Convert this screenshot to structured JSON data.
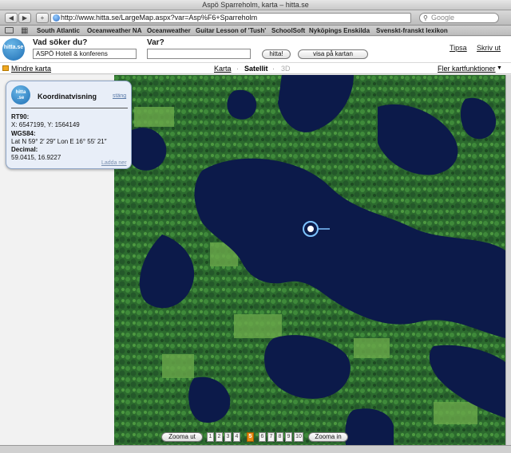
{
  "window": {
    "title": "Aspö Sparreholm, karta – hitta.se"
  },
  "toolbar": {
    "back": "◀",
    "forward": "▶",
    "add": "+",
    "url": "http://www.hitta.se/LargeMap.aspx?var=Asp%F6+Sparreholm",
    "reload": "C",
    "search_placeholder": "Google"
  },
  "bookmarks": [
    "South Atlantic",
    "Oceanweather NA",
    "Oceanweather",
    "Guitar Lesson of 'Tush'",
    "SchoolSoft",
    "Nyköpings Enskilda",
    "Svenskt-franskt lexikon"
  ],
  "header": {
    "logo": "hitta.se",
    "what_label": "Vad söker du?",
    "what_value": "ASPÖ Hotell & konferens",
    "where_label": "Var?",
    "where_value": "",
    "search_button": "hitta!",
    "show_map_button": "visa på kartan",
    "tipsa": "Tipsa",
    "print": "Skriv ut"
  },
  "mapbar": {
    "smaller_map": "Mindre karta",
    "karta": "Karta",
    "satellit": "Satellit",
    "threed": "3D",
    "more_functions": "Fler kartfunktioner"
  },
  "coord_popup": {
    "title": "Koordinatvisning",
    "close": "stäng",
    "rt90_label": "RT90:",
    "rt90_value": "X: 6547199, Y: 1564149",
    "wgs84_label": "WGS84:",
    "wgs84_value": "Lat N 59° 2′ 29″ Lon E 16° 55′ 21″",
    "decimal_label": "Decimal:",
    "decimal_value": "59.0415, 16.9227",
    "download": "Ladda ner"
  },
  "zoom": {
    "zoom_out": "Zooma ut",
    "zoom_in": "Zooma in",
    "levels": [
      "1",
      "2",
      "3",
      "4",
      "5",
      "6",
      "7",
      "8",
      "9",
      "10"
    ],
    "active_level": "5"
  },
  "colors": {
    "accent": "#e88a14",
    "water": "#0c1a4a",
    "forest": "#2f6a30"
  }
}
